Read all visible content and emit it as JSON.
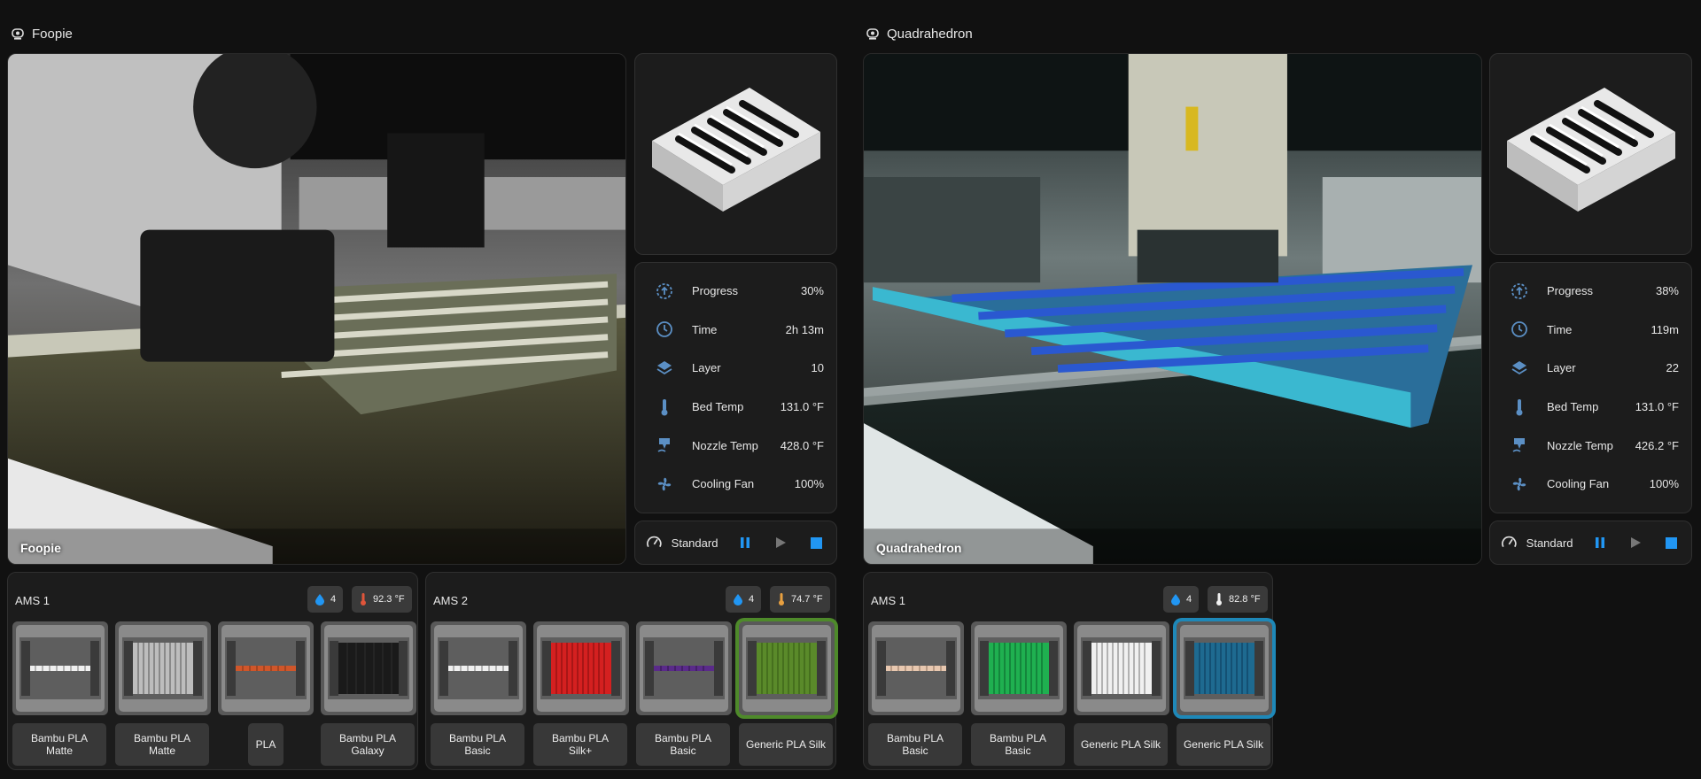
{
  "printers": [
    {
      "name": "Foopie",
      "camera_label": "Foopie",
      "stats": [
        {
          "label": "Progress",
          "value": "30%",
          "icon": "progress-icon"
        },
        {
          "label": "Time",
          "value": "2h 13m",
          "icon": "clock-icon"
        },
        {
          "label": "Layer",
          "value": "10",
          "icon": "layers-icon"
        },
        {
          "label": "Bed Temp",
          "value": "131.0 °F",
          "icon": "thermometer-icon"
        },
        {
          "label": "Nozzle Temp",
          "value": "428.0 °F",
          "icon": "nozzle-icon"
        },
        {
          "label": "Cooling Fan",
          "value": "100%",
          "icon": "fan-icon"
        }
      ],
      "speed": "Standard",
      "ams": [
        {
          "title": "AMS 1",
          "humidity": "4",
          "temperature": "92.3 °F",
          "temp_color": "#e0553a",
          "slots": [
            {
              "name": "Bambu PLA\nMatte",
              "color": "#f0f0f0"
            },
            {
              "name": "Bambu PLA\nMatte",
              "color": "#bdbdbd"
            },
            {
              "name": "PLA",
              "color": "#d0562a"
            },
            {
              "name": "Bambu PLA\nGalaxy",
              "color": "#1a1a1a"
            }
          ]
        },
        {
          "title": "AMS 2",
          "humidity": "4",
          "temperature": "74.7 °F",
          "temp_color": "#e8a040",
          "slots": [
            {
              "name": "Bambu PLA\nBasic",
              "color": "#f0f0f0"
            },
            {
              "name": "Bambu PLA\nSilk+",
              "color": "#d42020"
            },
            {
              "name": "Bambu PLA\nBasic",
              "color": "#5a2a8a"
            },
            {
              "name": "Generic PLA Silk",
              "color": "#5a8a2a",
              "active": "green"
            }
          ]
        }
      ]
    },
    {
      "name": "Quadrahedron",
      "camera_label": "Quadrahedron",
      "stats": [
        {
          "label": "Progress",
          "value": "38%",
          "icon": "progress-icon"
        },
        {
          "label": "Time",
          "value": "119m",
          "icon": "clock-icon"
        },
        {
          "label": "Layer",
          "value": "22",
          "icon": "layers-icon"
        },
        {
          "label": "Bed Temp",
          "value": "131.0 °F",
          "icon": "thermometer-icon"
        },
        {
          "label": "Nozzle Temp",
          "value": "426.2 °F",
          "icon": "nozzle-icon"
        },
        {
          "label": "Cooling Fan",
          "value": "100%",
          "icon": "fan-icon"
        }
      ],
      "speed": "Standard",
      "ams": [
        {
          "title": "AMS 1",
          "humidity": "4",
          "temperature": "82.8 °F",
          "temp_color": "#f0f0f0",
          "slots": [
            {
              "name": "Bambu PLA\nBasic",
              "color": "#e8c8b0"
            },
            {
              "name": "Bambu PLA\nBasic",
              "color": "#1fb050"
            },
            {
              "name": "Generic PLA Silk",
              "color": "#f0f0f0"
            },
            {
              "name": "Generic PLA Silk",
              "color": "#1e6a90",
              "active": "blue"
            }
          ]
        }
      ]
    }
  ],
  "colors": {
    "accent": "#2196f3",
    "icon": "#5b8fc4"
  }
}
